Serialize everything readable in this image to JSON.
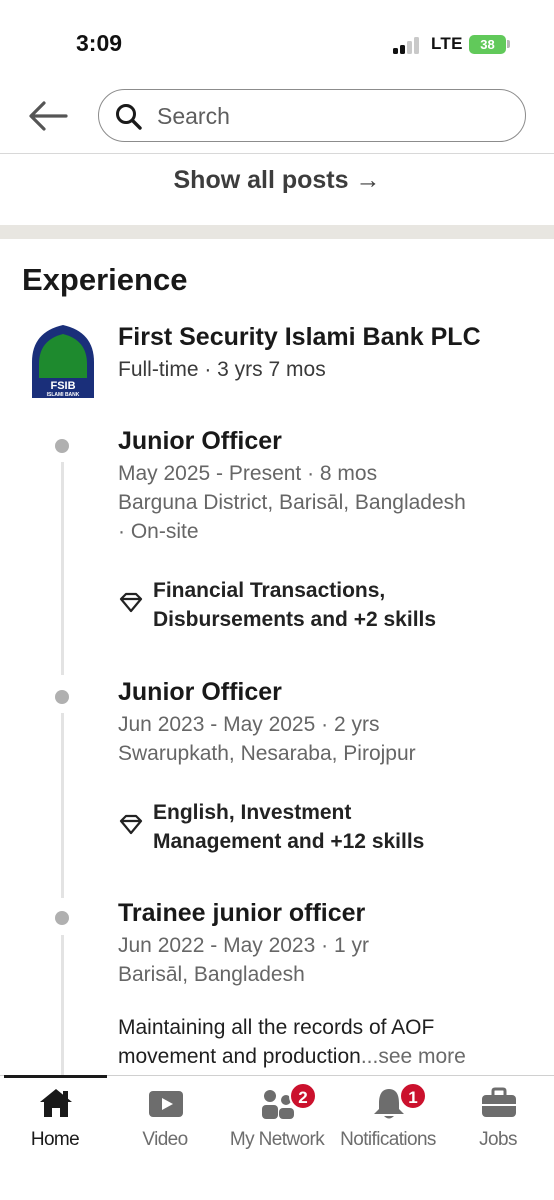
{
  "status_bar": {
    "time": "3:09",
    "network": "LTE",
    "battery": "38"
  },
  "search": {
    "placeholder": "Search"
  },
  "show_all_posts": "Show all posts →",
  "experience": {
    "heading": "Experience",
    "company": {
      "name": "First Security Islami Bank PLC",
      "meta": "Full-time · 3 yrs 7 mos",
      "logo_text": "FSIB",
      "logo_subtext": "ISLAMI BANK"
    },
    "roles": [
      {
        "title": "Junior Officer",
        "dates": "May 2025 - Present · 8 mos",
        "location_line1": "Barguna District, Barisāl, Bangladesh",
        "location_line2": "· On-site",
        "skills_line1": "Financial Transactions,",
        "skills_line2": "Disbursements and +2 skills"
      },
      {
        "title": "Junior Officer",
        "dates": "Jun 2023 - May 2025 · 2 yrs",
        "location_line1": "Swarupkath, Nesaraba, Pirojpur",
        "skills_line1": "English, Investment",
        "skills_line2": "Management and +12 skills"
      },
      {
        "title": "Trainee junior officer",
        "dates": "Jun 2022 - May 2023 · 1 yr",
        "location_line1": "Barisāl, Bangladesh",
        "description": "Maintaining all the records of AOF movement and production",
        "see_more": "...see more"
      }
    ]
  },
  "nav": {
    "items": [
      {
        "label": "Home",
        "icon": "home-icon"
      },
      {
        "label": "Video",
        "icon": "video-icon"
      },
      {
        "label": "My Network",
        "icon": "network-icon",
        "badge": "2"
      },
      {
        "label": "Notifications",
        "icon": "bell-icon",
        "badge": "1"
      },
      {
        "label": "Jobs",
        "icon": "briefcase-icon"
      }
    ]
  },
  "colors": {
    "badge": "#cb112d",
    "battery": "#61c95a",
    "logo_green": "#1e8a2e",
    "logo_navy": "#1a2f7a"
  }
}
